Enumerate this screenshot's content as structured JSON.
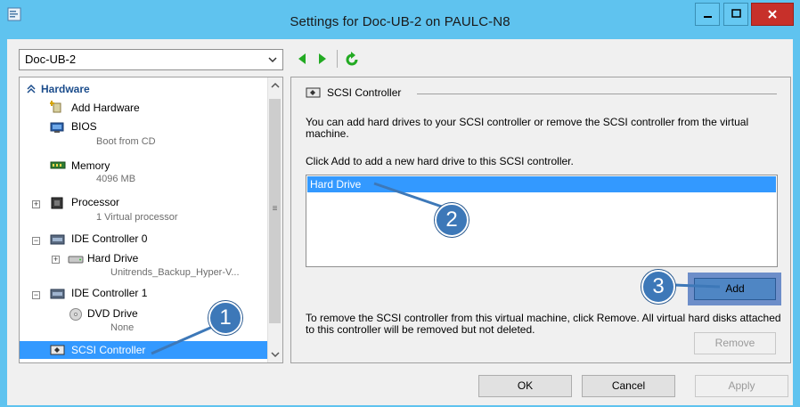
{
  "window": {
    "title": "Settings for Doc-UB-2 on PAULC-N8",
    "minimize": "─",
    "maximize": "□",
    "close": "x"
  },
  "vm_selector": {
    "value": "Doc-UB-2",
    "chevron": "⌄"
  },
  "tree": {
    "section": "Hardware",
    "items": [
      {
        "label": "Add Hardware",
        "icon": "add-hardware-icon"
      },
      {
        "label": "BIOS",
        "sub": "Boot from CD",
        "icon": "bios-icon"
      },
      {
        "label": "Memory",
        "sub": "4096 MB",
        "icon": "memory-icon"
      },
      {
        "label": "Processor",
        "sub": "1 Virtual processor",
        "icon": "processor-icon",
        "expander": "+"
      },
      {
        "label": "IDE Controller 0",
        "icon": "ide-controller-icon",
        "expander": "−"
      },
      {
        "label": "Hard Drive",
        "sub": "Unitrends_Backup_Hyper-V...",
        "icon": "hard-drive-icon",
        "expander": "+"
      },
      {
        "label": "IDE Controller 1",
        "icon": "ide-controller-icon",
        "expander": "−"
      },
      {
        "label": "DVD Drive",
        "sub": "None",
        "icon": "dvd-drive-icon"
      },
      {
        "label": "SCSI Controller",
        "icon": "scsi-controller-icon",
        "selected": true
      }
    ],
    "scroll_mid": "≡"
  },
  "panel": {
    "header": "SCSI Controller",
    "description": "You can add hard drives to your SCSI controller or remove the SCSI controller from the virtual machine.",
    "instruction": "Click Add to add a new hard drive to this SCSI controller.",
    "list_items": [
      "Hard Drive"
    ],
    "add_label": "Add",
    "remove_text": "To remove the SCSI controller from this virtual machine, click Remove. All virtual hard disks attached to this controller will be removed but not deleted.",
    "remove_label": "Remove"
  },
  "footer": {
    "ok": "OK",
    "cancel": "Cancel",
    "apply": "Apply"
  },
  "callouts": [
    "1",
    "2",
    "3"
  ],
  "colors": {
    "title_bar": "#5fc3ef",
    "selection": "#3399ff",
    "callout": "#3d78b8",
    "close_button": "#c7302a",
    "nav_arrow": "#22aa22"
  }
}
